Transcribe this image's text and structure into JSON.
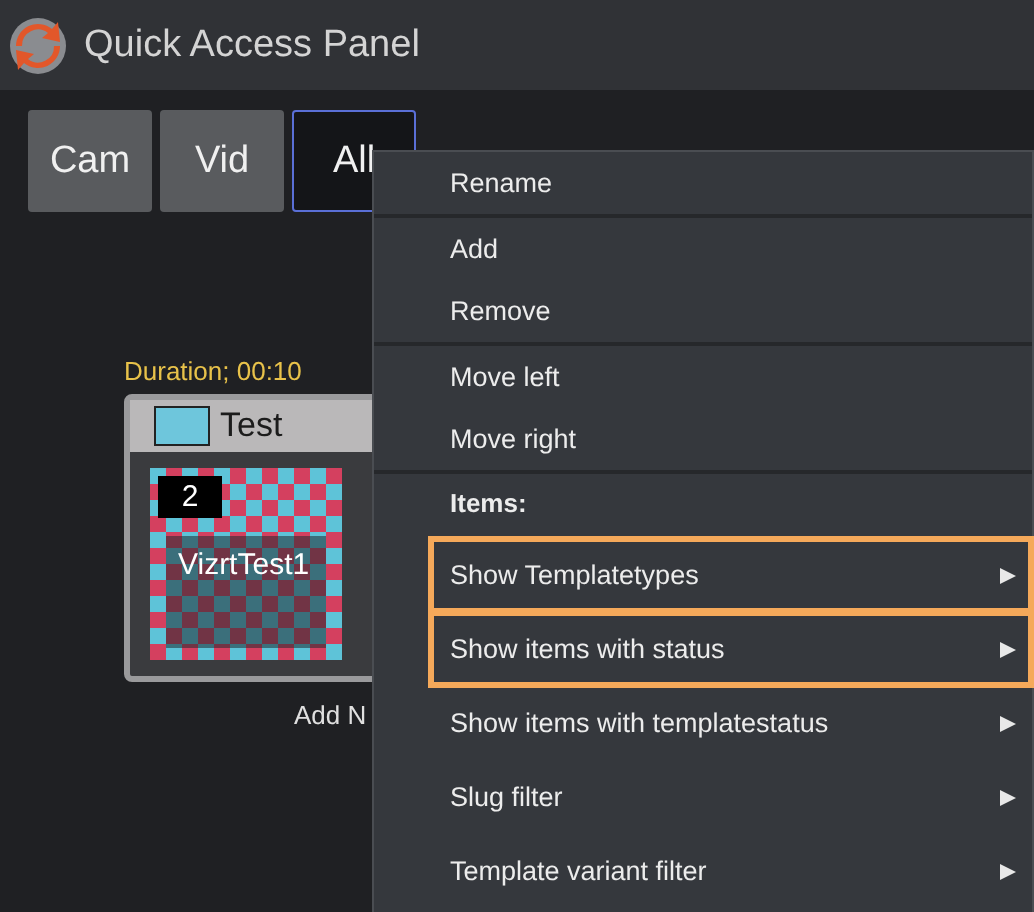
{
  "window": {
    "title": "Quick Access Panel"
  },
  "tabs": [
    {
      "label": "Cam",
      "selected": false
    },
    {
      "label": "Vid",
      "selected": false
    },
    {
      "label": "All",
      "selected": true
    }
  ],
  "item_card": {
    "duration": "Duration; 00:10",
    "title": "Test",
    "color": "#6ec6dc",
    "number": "2",
    "name": "VizrtTest1"
  },
  "add_label": "Add N",
  "context_menu": [
    {
      "kind": "item",
      "label": "Rename"
    },
    {
      "kind": "separator"
    },
    {
      "kind": "item",
      "label": "Add"
    },
    {
      "kind": "item",
      "label": "Remove"
    },
    {
      "kind": "separator"
    },
    {
      "kind": "item",
      "label": "Move left"
    },
    {
      "kind": "item",
      "label": "Move right"
    },
    {
      "kind": "separator"
    },
    {
      "kind": "header",
      "label": "Items:"
    },
    {
      "kind": "submenu",
      "label": "Show Templatetypes",
      "highlighted": true
    },
    {
      "kind": "submenu",
      "label": "Show items with status",
      "highlighted": true
    },
    {
      "kind": "submenu",
      "label": "Show items with templatestatus",
      "highlighted": false
    },
    {
      "kind": "submenu",
      "label": "Slug filter",
      "highlighted": false
    },
    {
      "kind": "submenu",
      "label": "Template variant filter",
      "highlighted": false
    }
  ]
}
